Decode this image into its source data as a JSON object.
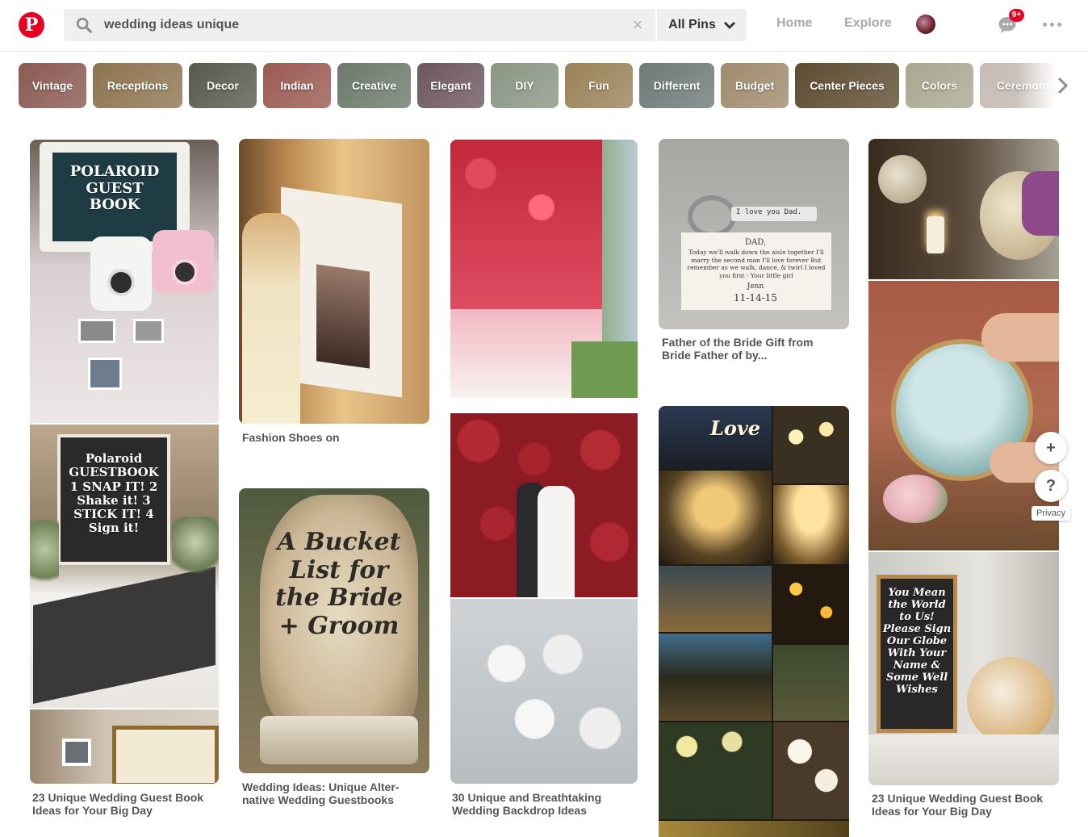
{
  "header": {
    "logo_letter": "P",
    "search": {
      "value": "wedding ideas unique",
      "clear_glyph": "×",
      "scope_label": "All Pins"
    },
    "nav": {
      "home": "Home",
      "explore": "Explore"
    },
    "notifications_badge": "9+"
  },
  "guides": [
    {
      "label": "Vintage",
      "color": "#8a5a52"
    },
    {
      "label": "Receptions",
      "color": "#8e7450"
    },
    {
      "label": "Decor",
      "color": "#575a4c"
    },
    {
      "label": "Indian",
      "color": "#9a5a52"
    },
    {
      "label": "Creative",
      "color": "#6c7a6a"
    },
    {
      "label": "Elegant",
      "color": "#6e5660"
    },
    {
      "label": "DIY",
      "color": "#8a9684"
    },
    {
      "label": "Fun",
      "color": "#9a8258"
    },
    {
      "label": "Different",
      "color": "#6d7a78"
    },
    {
      "label": "Budget",
      "color": "#a08a6c"
    },
    {
      "label": "Center Pieces",
      "color": "#5e4c32"
    },
    {
      "label": "Colors",
      "color": "#a8a890"
    },
    {
      "label": "Ceremony",
      "color": "#c6bcb4"
    }
  ],
  "pins": {
    "c1": {
      "label_1": "POLAROID GUEST BOOK",
      "label_2": "Polaroid GUESTBOOK 1 SNAP IT! 2 Shake it! 3 STICK IT! 4 Sign it!",
      "title": "23 Unique Wedding Guest Book Ideas for Your Big Day"
    },
    "c2": {
      "title_1": "Fashion Shoes on",
      "label_2": "A Bucket List for the Bride + Groom",
      "title_2": "Wedding Ideas: Unique Alter-native Wedding Guestbooks"
    },
    "c3": {
      "title": "30 Unique and Breathtaking Wedding Backdrop Ideas"
    },
    "c4": {
      "tag": "I love you Dad.",
      "card_heading": "DAD,",
      "card_body": "Today we'll walk down the aisle together I'll marry the second man I'll love forever But remember as we walk, dance, & twirl I loved you first - Your little girl",
      "card_sign": "Jenn",
      "card_date": "11-14-15",
      "title": "Father of the Bride Gift from Bride Father of by...",
      "love_script": "Love"
    },
    "c5": {
      "label": "You Mean the World to Us! Please Sign Our Globe With Your Name & Some Well Wishes",
      "title": "23 Unique Wedding Guest Book Ideas for Your Big Day"
    }
  },
  "side": {
    "add": "+",
    "help": "?",
    "privacy": "Privacy"
  }
}
